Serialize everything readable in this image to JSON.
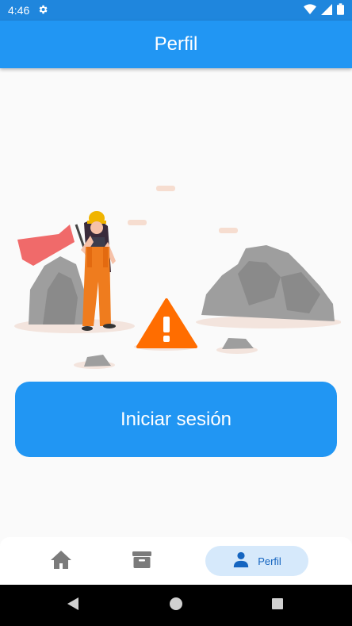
{
  "status_bar": {
    "time": "4:46",
    "icons": [
      "settings-icon",
      "wifi-icon",
      "signal-icon",
      "battery-icon"
    ]
  },
  "app_bar": {
    "title": "Perfil"
  },
  "illustration": {
    "icons": [
      "worker-figure",
      "flag-icon",
      "rock-icon",
      "warning-triangle-icon"
    ]
  },
  "main": {
    "login_label": "Iniciar sesión"
  },
  "bottom_nav": {
    "items": [
      {
        "icon": "home-icon",
        "label": ""
      },
      {
        "icon": "archive-icon",
        "label": ""
      },
      {
        "icon": "person-icon",
        "label": "Perfil",
        "active": true
      }
    ]
  },
  "colors": {
    "primary": "#2196f3",
    "status_bar": "#1f86dd",
    "warning": "#ff6d00",
    "nav_active_bg": "#d6e9fb"
  }
}
